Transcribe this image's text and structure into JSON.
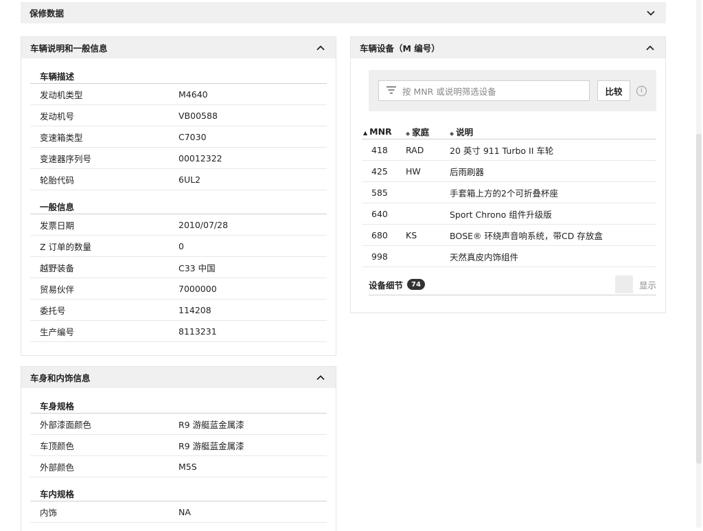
{
  "warranty": {
    "title": "保修数据"
  },
  "general": {
    "title": "车辆说明和一般信息",
    "vehicle_desc_title": "车辆描述",
    "vehicle_desc": [
      {
        "k": "发动机类型",
        "v": "M4640"
      },
      {
        "k": "发动机号",
        "v": "VB00588"
      },
      {
        "k": "变速箱类型",
        "v": "C7030"
      },
      {
        "k": "变速器序列号",
        "v": "00012322"
      },
      {
        "k": "轮胎代码",
        "v": "6UL2"
      }
    ],
    "general_info_title": "一般信息",
    "general_info": [
      {
        "k": "发票日期",
        "v": "2010/07/28"
      },
      {
        "k": "Z 订单的数量",
        "v": "0"
      },
      {
        "k": "越野装备",
        "v": "C33 中国"
      },
      {
        "k": "贸易伙伴",
        "v": "7000000"
      },
      {
        "k": "委托号",
        "v": "114208"
      },
      {
        "k": "生产编号",
        "v": "8113231"
      }
    ]
  },
  "body_info": {
    "title": "车身和内饰信息",
    "body_spec_title": "车身规格",
    "body_spec": [
      {
        "k": "外部漆面颜色",
        "v": "R9 游艇蓝金属漆"
      },
      {
        "k": "车顶颜色",
        "v": "R9 游艇蓝金属漆"
      },
      {
        "k": "外部颜色",
        "v": "M5S"
      }
    ],
    "interior_spec_title": "车内规格",
    "interior_spec": [
      {
        "k": "内饰",
        "v": "NA"
      }
    ]
  },
  "equipment": {
    "title": "车辆设备（M 编号）",
    "filter_placeholder": "按 MNR 或说明筛选设备",
    "compare_label": "比较",
    "info_icon": "i",
    "columns": [
      "MNR",
      "家庭",
      "说明"
    ],
    "rows": [
      {
        "mnr": "418",
        "family": "RAD",
        "desc": "20 英寸 911 Turbo II 车轮"
      },
      {
        "mnr": "425",
        "family": "HW",
        "desc": "后雨刷器"
      },
      {
        "mnr": "585",
        "family": "",
        "desc": "手套箱上方的2个可折叠杯座"
      },
      {
        "mnr": "640",
        "family": "",
        "desc": "Sport Chrono 组件升级版"
      },
      {
        "mnr": "680",
        "family": "KS",
        "desc": "BOSE® 环绕声音响系统，带CD 存放盒"
      },
      {
        "mnr": "998",
        "family": "",
        "desc": "天然真皮内饰组件"
      }
    ],
    "details_label": "设备细节",
    "details_count": "74",
    "show_label": "显示"
  },
  "icons": {
    "chevron_down": "chevron-down-icon",
    "chevron_up": "chevron-up-icon",
    "filter": "filter-icon",
    "info": "info-icon",
    "sort": "sort-icon"
  }
}
